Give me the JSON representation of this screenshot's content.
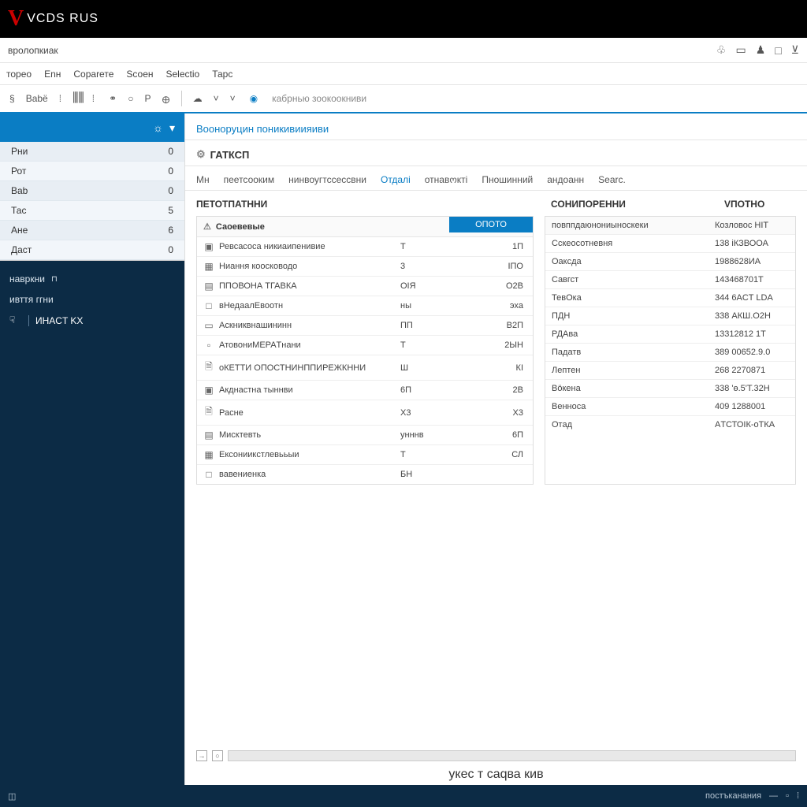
{
  "brand": {
    "name": "VCDS RUS"
  },
  "breadcrumb": "вролопкиак",
  "menu": [
    "торео",
    "Enн",
    "Сораrете",
    "Sсоен",
    "Sеlectіо",
    "Тарс"
  ],
  "toolbar": {
    "left_labels": [
      "Bаbё"
    ],
    "hint": "кабрнью зоокоокниви"
  },
  "sidebar": {
    "items": [
      {
        "label": "Рни",
        "count": "0"
      },
      {
        "label": "Рот",
        "count": "0"
      },
      {
        "label": "Ваb",
        "count": "0"
      },
      {
        "label": "Тас",
        "count": "5"
      },
      {
        "label": "Ане",
        "count": "6"
      },
      {
        "label": "Даст",
        "count": "0"
      }
    ],
    "dark": {
      "group": "навркни",
      "rows": [
        {
          "label": "ивття ггни"
        },
        {
          "label": "ИНАCT KX"
        }
      ]
    }
  },
  "main": {
    "section": "Вооноруцин поникивиияиви",
    "panel_title": "ГАТКСП",
    "tabs": [
      "Мн",
      "пеетсооким",
      "нинвоугтссессвни",
      "Отдалі",
      "отнавოкті",
      "Пношинний",
      "андоанн",
      "Sеаrс."
    ],
    "active_tab_index": 3,
    "column_headers": [
      "ПЕТОТПАТННИ",
      "СОНИПОРЕННИ",
      "VПОТНО"
    ]
  },
  "panel_left": {
    "header_label": "Саоевевые",
    "header_button": "ОПОТО",
    "rows": [
      {
        "icon": "▣",
        "label": "Ревсaсосa никиаипенивие",
        "c2": "Т",
        "c3": "1П"
      },
      {
        "icon": "▦",
        "label": "Ниання коосководо",
        "c2": "3",
        "c3": "ІПО"
      },
      {
        "icon": "▤",
        "label": "ППОВОНА ТГАВКА",
        "c2": "ОІЯ",
        "c3": "О2В"
      },
      {
        "icon": "□",
        "label": "вНедаалЕвοотн",
        "c2": "ны",
        "c3": "эхa"
      },
      {
        "icon": "▭",
        "label": "Аскниквнашининн",
        "c2": "ПП",
        "c3": "В2П"
      },
      {
        "icon": "▫",
        "label": "АтовониМЕPAТнани",
        "c2": "Т",
        "c3": "2ЫН"
      },
      {
        "icon": "🗎",
        "label": "оКЕТТИ ОПОСТНИНППИРЕЖКННИ",
        "c2": "Ш",
        "c3": "КІ"
      },
      {
        "icon": "▣",
        "label": "Акднастна тыннви",
        "c2": "6П",
        "c3": "2В"
      },
      {
        "icon": "🗎",
        "label": "Расне",
        "c2": "Х3",
        "c3": "Х3"
      },
      {
        "icon": "▤",
        "label": "Мисктевть",
        "c2": "унннв",
        "c3": "6П"
      },
      {
        "icon": "▦",
        "label": "Ексониикстлевььыи",
        "c2": "Т",
        "c3": "СЛ"
      },
      {
        "icon": "□",
        "label": "вавениенка",
        "c2": "БН",
        "c3": ""
      }
    ]
  },
  "panel_right": {
    "rows": [
      {
        "label": "повппдаюнониыноскеки",
        "value": "Козловос HIT"
      },
      {
        "label": "Сскеосотневня",
        "value": "138 іКЗВООА"
      },
      {
        "label": "Оаксда",
        "value": "1988628ИА"
      },
      {
        "label": "Cавгст",
        "value": "143468701Т"
      },
      {
        "label": "ТевОка",
        "value": "344 6ACT LDА"
      },
      {
        "label": "ПДН",
        "value": "338 АКШ.О2Н"
      },
      {
        "label": "РДАва",
        "value": "13312812 1Т"
      },
      {
        "label": "Падатв",
        "value": "389 00652.9.0"
      },
      {
        "label": "Лептен",
        "value": "268 2270871"
      },
      {
        "label": "Böкена",
        "value": "338 'ө.5'T.32Н"
      },
      {
        "label": "Венноса",
        "value": "409 1288001"
      },
      {
        "label": "Отад",
        "value": "AТСТОІК-оТКА"
      }
    ]
  },
  "footer": "укес т саqва кив",
  "status": {
    "right_text": "постъканания"
  }
}
